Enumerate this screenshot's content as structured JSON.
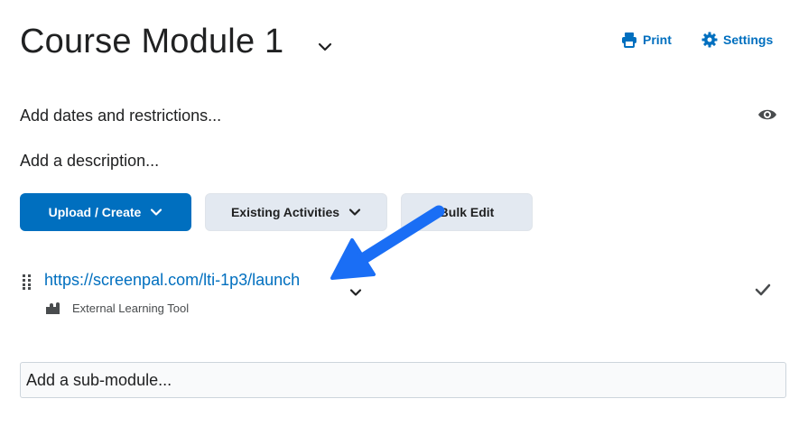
{
  "header": {
    "title": "Course Module 1",
    "print_label": "Print",
    "settings_label": "Settings"
  },
  "module": {
    "dates_link": "Add dates and restrictions...",
    "description_link": "Add a description..."
  },
  "toolbar": {
    "upload_create_label": "Upload / Create",
    "existing_activities_label": "Existing Activities",
    "bulk_edit_label": "Bulk Edit"
  },
  "topic": {
    "link_text": "https://screenpal.com/lti-1p3/launch",
    "type_label": "External Learning Tool"
  },
  "submodule": {
    "placeholder": "Add a sub-module..."
  },
  "icons": {
    "title_menu": "chevron-down-icon",
    "print": "printer-icon",
    "settings": "gear-icon",
    "visibility": "eye-icon",
    "drag": "drag-handle-icon",
    "topic_menu": "chevron-down-icon",
    "tool_type": "puzzle-piece-icon",
    "completion": "checkmark-icon"
  },
  "colors": {
    "accent": "#006fbf",
    "secondary_button": "#e3e9f1",
    "text": "#202122",
    "annotation_arrow": "#1a6ef5"
  }
}
